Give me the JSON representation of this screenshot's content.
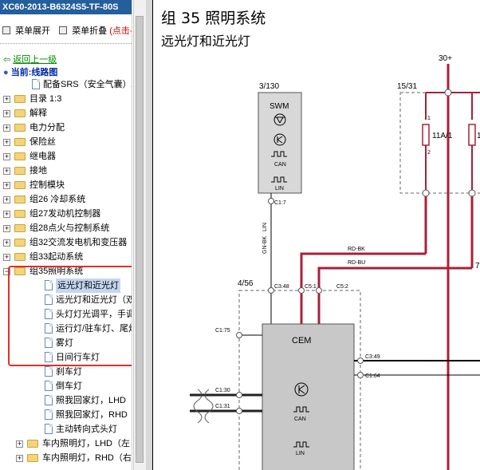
{
  "window": {
    "title": "XC60-2013-B6324S5-TF-80S"
  },
  "toolbar": {
    "expand": "菜单展开",
    "collapse": "菜单折叠",
    "collapse_hint": "(点击-"
  },
  "nav": {
    "back": "返回上一级",
    "current": "当前:线路图"
  },
  "tree": {
    "items": [
      {
        "label": "配备SRS（安全气囊）/SI",
        "type": "doc",
        "indent": 1
      },
      {
        "label": "目录 1:3",
        "type": "folder",
        "indent": 0
      },
      {
        "label": "解释",
        "type": "folder",
        "indent": 0
      },
      {
        "label": "电力分配",
        "type": "folder",
        "indent": 0
      },
      {
        "label": "保险丝",
        "type": "folder",
        "indent": 0
      },
      {
        "label": "继电器",
        "type": "folder",
        "indent": 0
      },
      {
        "label": "接地",
        "type": "folder",
        "indent": 0
      },
      {
        "label": "控制模块",
        "type": "folder",
        "indent": 0
      },
      {
        "label": "组26 冷却系统",
        "type": "folder",
        "indent": 0
      },
      {
        "label": "组27发动机控制器",
        "type": "folder",
        "indent": 0
      },
      {
        "label": "组28点火与控制系统",
        "type": "folder",
        "indent": 0
      },
      {
        "label": "组32交流发电机和变压器",
        "type": "folder",
        "indent": 0
      },
      {
        "label": "组33起动系统",
        "type": "folder",
        "indent": 0
      },
      {
        "label": "组35照明系统",
        "type": "folder-open",
        "indent": 0
      },
      {
        "label": "远光灯和近光灯",
        "type": "doc",
        "indent": 2,
        "selected": true
      },
      {
        "label": "远光灯和近光灯（双氙",
        "type": "doc",
        "indent": 2
      },
      {
        "label": "头灯灯光调平，手调",
        "type": "doc",
        "indent": 2
      },
      {
        "label": "运行灯/驻车灯、尾灯",
        "type": "doc",
        "indent": 2
      },
      {
        "label": "雾灯",
        "type": "doc",
        "indent": 2
      },
      {
        "label": "日间行车灯",
        "type": "doc",
        "indent": 2
      },
      {
        "label": "刹车灯",
        "type": "doc",
        "indent": 2
      },
      {
        "label": "倒车灯",
        "type": "doc",
        "indent": 2
      },
      {
        "label": "照我回家灯，LHD（左",
        "type": "doc",
        "indent": 2
      },
      {
        "label": "照我回家灯，RHD（右",
        "type": "doc",
        "indent": 2
      },
      {
        "label": "主动转向式头灯",
        "type": "doc",
        "indent": 2
      },
      {
        "label": "车内照明灯，LHD（左",
        "type": "folder",
        "indent": 1
      },
      {
        "label": "车内照明灯，RHD（右",
        "type": "folder",
        "indent": 1
      }
    ]
  },
  "doc": {
    "group_title": "组 35 照明系统",
    "subtitle": "远光灯和近光灯"
  },
  "schematic": {
    "supply": "30+",
    "fuse_box": "15/31",
    "fuse_label": "11A/1",
    "fuse_label2": "1",
    "pin1": "1",
    "pin2": "2",
    "swm_ref": "3/130",
    "swm_name": "SWM",
    "swm_can": "CAN",
    "swm_lin": "LIN",
    "swm_conn": "C1:7",
    "wire_gnbk": "GN-BK",
    "wire_lin": "LIN",
    "wire_rdbk": "RD-BK",
    "wire_rdbu": "RD-BU",
    "wire_num": "7",
    "cem_ref": "4/56",
    "cem_name": "CEM",
    "cem_can": "CAN",
    "cem_lin": "LIN",
    "conn_c348": "C3:48",
    "conn_c51": "C5:1",
    "conn_c52": "C5:2",
    "conn_c175": "C1:75",
    "conn_c349": "C3:49",
    "conn_c164": "C1:64",
    "conn_c130": "C1:30",
    "conn_c131": "C1:31"
  },
  "colors": {
    "wire_red": "#a8203a",
    "titlebar": "#245e9c",
    "highlight_box": "#e0302a",
    "cem_fill": "#c8c8c8"
  }
}
